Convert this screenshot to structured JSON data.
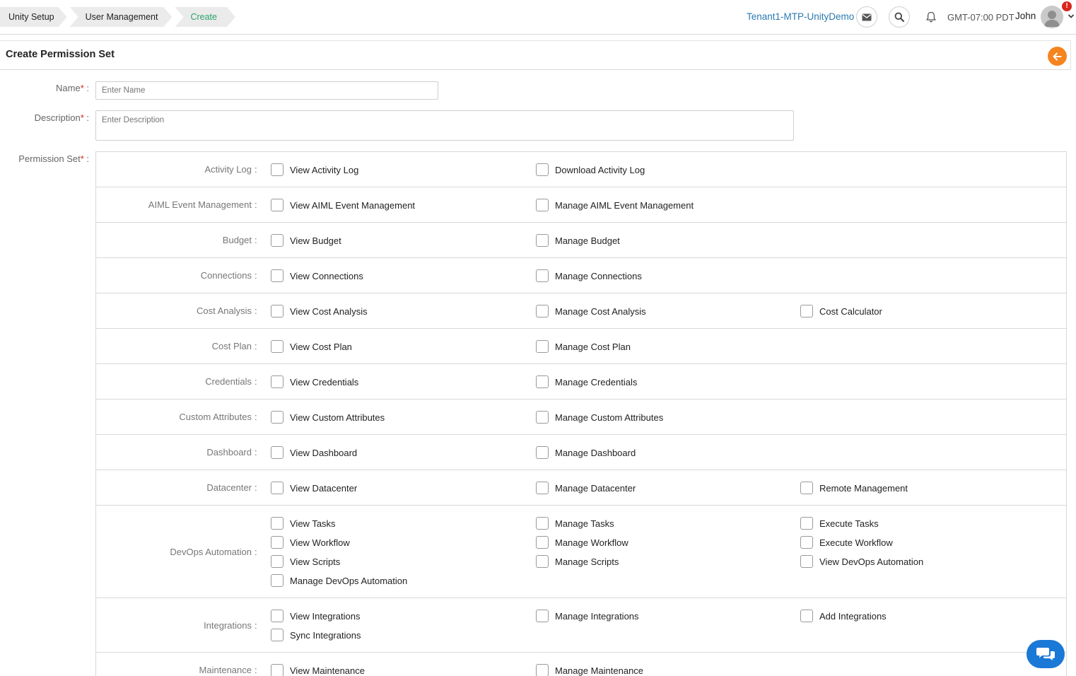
{
  "breadcrumb": [
    "Unity Setup",
    "User Management",
    "Create"
  ],
  "header": {
    "tenant": "Tenant1-MTP-UnityDemo",
    "timezone": "GMT-07:00 PDT",
    "user": "John",
    "alert_badge": "!"
  },
  "page": {
    "title": "Create Permission Set"
  },
  "form": {
    "name_label": "Name",
    "name_placeholder": "Enter Name",
    "description_label": "Description",
    "description_placeholder": "Enter Description",
    "permission_label": "Permission Set",
    "required_mark": "*",
    "colon": " :"
  },
  "permissions": [
    {
      "label": "Activity Log",
      "options": [
        "View Activity Log",
        "Download Activity Log"
      ]
    },
    {
      "label": "AIML Event Management",
      "options": [
        "View AIML Event Management",
        "Manage AIML Event Management"
      ]
    },
    {
      "label": "Budget",
      "options": [
        "View Budget",
        "Manage Budget"
      ]
    },
    {
      "label": "Connections",
      "options": [
        "View Connections",
        "Manage Connections"
      ]
    },
    {
      "label": "Cost Analysis",
      "options": [
        "View Cost Analysis",
        "Manage Cost Analysis",
        "Cost Calculator"
      ]
    },
    {
      "label": "Cost Plan",
      "options": [
        "View Cost Plan",
        "Manage Cost Plan"
      ]
    },
    {
      "label": "Credentials",
      "options": [
        "View Credentials",
        "Manage Credentials"
      ]
    },
    {
      "label": "Custom Attributes",
      "options": [
        "View Custom Attributes",
        "Manage Custom Attributes"
      ]
    },
    {
      "label": "Dashboard",
      "options": [
        "View Dashboard",
        "Manage Dashboard"
      ]
    },
    {
      "label": "Datacenter",
      "options": [
        "View Datacenter",
        "Manage Datacenter",
        "Remote Management"
      ]
    },
    {
      "label": "DevOps Automation",
      "options": [
        "View Tasks",
        "Manage Tasks",
        "Execute Tasks",
        "View Workflow",
        "Manage Workflow",
        "Execute Workflow",
        "View Scripts",
        "Manage Scripts",
        "View DevOps Automation",
        "Manage DevOps Automation"
      ]
    },
    {
      "label": "Integrations",
      "options": [
        "View Integrations",
        "Manage Integrations",
        "Add Integrations",
        "Sync Integrations"
      ]
    },
    {
      "label": "Maintenance",
      "options": [
        "View Maintenance",
        "Manage Maintenance"
      ]
    }
  ],
  "colors": {
    "accent_green": "#2aa36b",
    "link_blue": "#2a7ab0",
    "back_orange": "#f5841f",
    "chat_blue": "#1a78d6",
    "required_red": "#d9261c"
  }
}
